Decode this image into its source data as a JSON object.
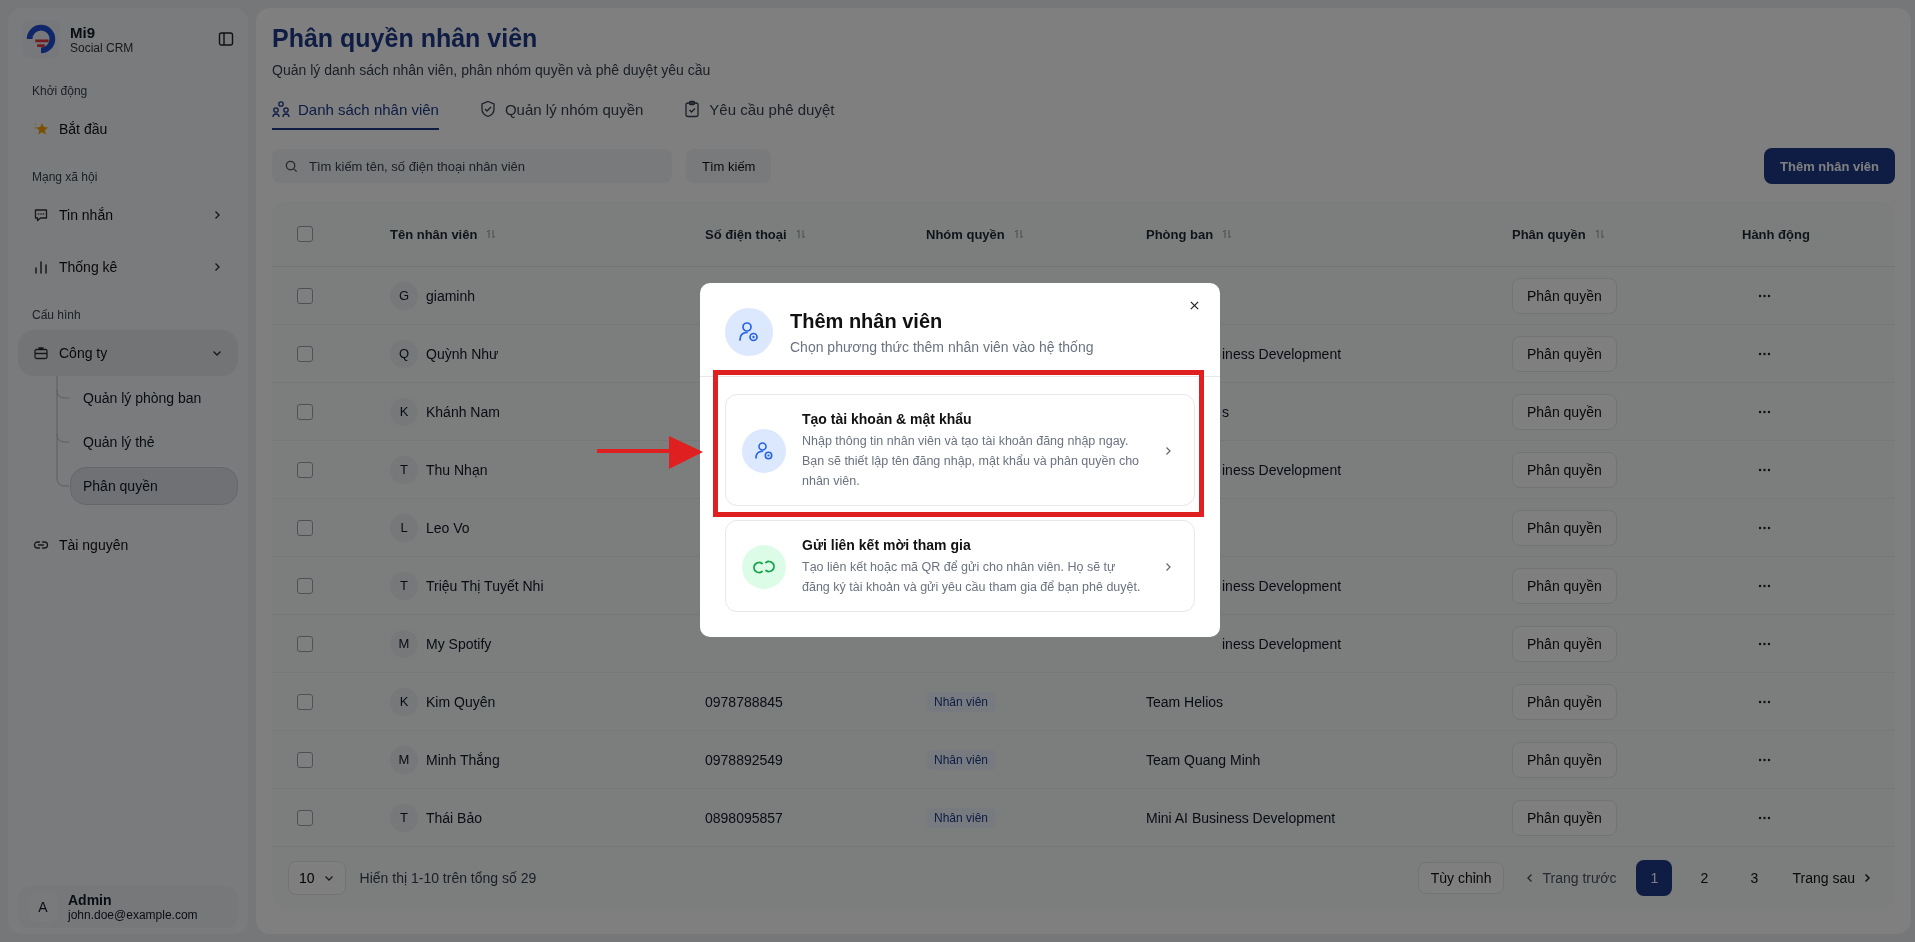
{
  "sidebar": {
    "brand": {
      "name": "Mi9",
      "subtitle": "Social CRM"
    },
    "sections": [
      {
        "label": "Khởi động",
        "items": [
          {
            "label": "Bắt đầu",
            "selected": false
          }
        ]
      },
      {
        "label": "Mạng xã hội",
        "items": [
          {
            "label": "Tin nhắn",
            "selected": false,
            "expanded": false
          },
          {
            "label": "Thống kê",
            "selected": false,
            "expanded": false
          }
        ]
      },
      {
        "label": "Cấu hình",
        "items": [
          {
            "label": "Công ty",
            "selected": false,
            "expanded": true,
            "children": [
              {
                "label": "Quản lý phòng ban",
                "selected": false
              },
              {
                "label": "Quản lý thẻ",
                "selected": false
              },
              {
                "label": "Phân quyền",
                "selected": true
              }
            ]
          },
          {
            "label": "Tài nguyên",
            "selected": false
          }
        ]
      }
    ],
    "user": {
      "initial": "A",
      "name": "Admin",
      "email": "john.doe@example.com"
    }
  },
  "page": {
    "title": "Phân quyền nhân viên",
    "subtitle": "Quản lý danh sách nhân viên, phân nhóm quyền và phê duyệt yêu cầu"
  },
  "tabs": [
    {
      "label": "Danh sách nhân viên",
      "selected": true
    },
    {
      "label": "Quản lý nhóm quyền",
      "selected": false
    },
    {
      "label": "Yêu cầu phê duyệt",
      "selected": false
    }
  ],
  "search": {
    "placeholder": "Tìm kiếm tên, số điện thoại nhân viên",
    "button": "Tìm kiếm"
  },
  "add_button": "Thêm nhân viên",
  "table": {
    "select_all_checked": false,
    "columns": [
      {
        "label": "Tên nhân viên",
        "sortable": true
      },
      {
        "label": "Số điện thoại",
        "sortable": true
      },
      {
        "label": "Nhóm quyền",
        "sortable": true
      },
      {
        "label": "Phòng ban",
        "sortable": true
      },
      {
        "label": "Phân quyền",
        "sortable": true
      },
      {
        "label": "Hành động",
        "sortable": false
      }
    ],
    "rows": [
      {
        "checked": false,
        "initial": "G",
        "name": "giaminh",
        "action": "Phân quyền"
      },
      {
        "checked": false,
        "initial": "Q",
        "name": "Quỳnh Như",
        "department": "iness Development",
        "covered": true,
        "action": "Phân quyền"
      },
      {
        "checked": false,
        "initial": "K",
        "name": "Khánh Nam",
        "department": "s",
        "covered": true,
        "action": "Phân quyền"
      },
      {
        "checked": false,
        "initial": "T",
        "name": "Thu Nhạn",
        "department": "iness Development",
        "covered": true,
        "action": "Phân quyền"
      },
      {
        "checked": false,
        "initial": "L",
        "name": "Leo Vo",
        "action": "Phân quyền"
      },
      {
        "checked": false,
        "initial": "T",
        "name": "Triệu Thị Tuyết Nhi",
        "department": "iness Development",
        "covered": true,
        "action": "Phân quyền"
      },
      {
        "checked": false,
        "initial": "M",
        "name": "My Spotify",
        "department": "iness Development",
        "covered": true,
        "action": "Phân quyền"
      },
      {
        "checked": false,
        "initial": "K",
        "name": "Kim Quyên",
        "phone": "0978788845",
        "group": "Nhân viên",
        "department": "Team Helios",
        "action": "Phân quyền"
      },
      {
        "checked": false,
        "initial": "M",
        "name": "Minh Thắng",
        "phone": "0978892549",
        "group": "Nhân viên",
        "department": "Team Quang Minh",
        "action": "Phân quyền"
      },
      {
        "checked": false,
        "initial": "T",
        "name": "Thái Bảo",
        "phone": "0898095857",
        "group": "Nhân viên",
        "department": "Mini AI Business Development",
        "action": "Phân quyền"
      }
    ]
  },
  "footer": {
    "page_size": "10",
    "summary": "Hiển thị 1-10 trên tổng số 29",
    "customize": "Tùy chỉnh",
    "prev": {
      "label": "Trang trước",
      "disabled": true
    },
    "pages": [
      {
        "label": "1",
        "selected": true
      },
      {
        "label": "2",
        "selected": false
      },
      {
        "label": "3",
        "selected": false
      }
    ],
    "next": {
      "label": "Trang sau",
      "disabled": false
    }
  },
  "modal": {
    "title": "Thêm nhân viên",
    "subtitle": "Chọn phương thức thêm nhân viên vào hệ thống",
    "options": [
      {
        "kind": "account",
        "title": "Tạo tài khoản & mật khẩu",
        "description": "Nhập thông tin nhân viên và tạo tài khoản đăng nhập ngay. Bạn sẽ thiết lập tên đăng nhập, mật khẩu và phân quyền cho nhân viên.",
        "annotated": true
      },
      {
        "kind": "invite",
        "title": "Gửi liên kết mời tham gia",
        "description": "Tạo liên kết hoặc mã QR để gửi cho nhân viên. Họ sẽ tự đăng ký tài khoản và gửi yêu cầu tham gia để bạn phê duyệt."
      }
    ]
  }
}
